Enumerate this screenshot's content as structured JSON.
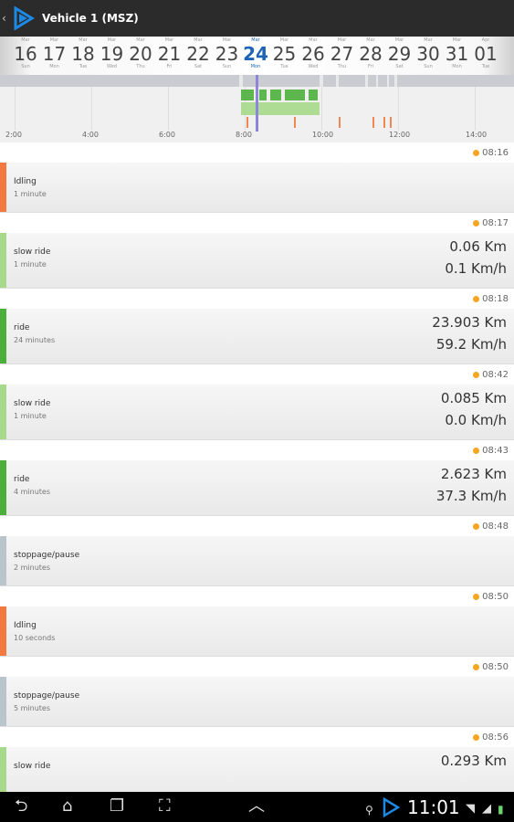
{
  "header": {
    "title": "Vehicle 1 (MSZ)",
    "back_glyph": "‹"
  },
  "dates": [
    {
      "mon": "Mar",
      "num": "16",
      "dow": "Sun",
      "selected": false
    },
    {
      "mon": "Mar",
      "num": "17",
      "dow": "Mon",
      "selected": false
    },
    {
      "mon": "Mar",
      "num": "18",
      "dow": "Tue",
      "selected": false
    },
    {
      "mon": "Mar",
      "num": "19",
      "dow": "Wed",
      "selected": false
    },
    {
      "mon": "Mar",
      "num": "20",
      "dow": "Thu",
      "selected": false
    },
    {
      "mon": "Mar",
      "num": "21",
      "dow": "Fri",
      "selected": false
    },
    {
      "mon": "Mar",
      "num": "22",
      "dow": "Sat",
      "selected": false
    },
    {
      "mon": "Mar",
      "num": "23",
      "dow": "Sun",
      "selected": false
    },
    {
      "mon": "Mar",
      "num": "24",
      "dow": "Mon",
      "selected": true
    },
    {
      "mon": "Mar",
      "num": "25",
      "dow": "Tue",
      "selected": false
    },
    {
      "mon": "Mar",
      "num": "26",
      "dow": "Wed",
      "selected": false
    },
    {
      "mon": "Mar",
      "num": "27",
      "dow": "Thu",
      "selected": false
    },
    {
      "mon": "Mar",
      "num": "28",
      "dow": "Fri",
      "selected": false
    },
    {
      "mon": "Mar",
      "num": "29",
      "dow": "Sat",
      "selected": false
    },
    {
      "mon": "Mar",
      "num": "30",
      "dow": "Sun",
      "selected": false
    },
    {
      "mon": "Mar",
      "num": "31",
      "dow": "Mon",
      "selected": false
    },
    {
      "mon": "Apr",
      "num": "01",
      "dow": "Tue",
      "selected": false
    }
  ],
  "timeline": {
    "hour_labels": [
      "2:00",
      "4:00",
      "6:00",
      "8:00",
      "10:00",
      "12:00",
      "14:00"
    ]
  },
  "events": [
    {
      "time": "08:16",
      "name": "Idling",
      "duration": "1 minute",
      "distance": "",
      "speed": "",
      "color": "#f07a3f"
    },
    {
      "time": "08:17",
      "name": "slow ride",
      "duration": "1 minute",
      "distance": "0.06 Km",
      "speed": "0.1 Km/h",
      "color": "#a6d98a"
    },
    {
      "time": "08:18",
      "name": "ride",
      "duration": "24 minutes",
      "distance": "23.903 Km",
      "speed": "59.2 Km/h",
      "color": "#4caf3c"
    },
    {
      "time": "08:42",
      "name": "slow ride",
      "duration": "1 minute",
      "distance": "0.085 Km",
      "speed": "0.0 Km/h",
      "color": "#a6d98a"
    },
    {
      "time": "08:43",
      "name": "ride",
      "duration": "4 minutes",
      "distance": "2.623 Km",
      "speed": "37.3 Km/h",
      "color": "#4caf3c"
    },
    {
      "time": "08:48",
      "name": "stoppage/pause",
      "duration": "2 minutes",
      "distance": "",
      "speed": "",
      "color": "#b9c4cc"
    },
    {
      "time": "08:50",
      "name": "Idling",
      "duration": "10 seconds",
      "distance": "",
      "speed": "",
      "color": "#f07a3f"
    },
    {
      "time": "08:50",
      "name": "stoppage/pause",
      "duration": "5 minutes",
      "distance": "",
      "speed": "",
      "color": "#b9c4cc"
    },
    {
      "time": "08:56",
      "name": "slow ride",
      "duration": "",
      "distance": "0.293 Km",
      "speed": "",
      "color": "#a6d98a"
    }
  ],
  "statusbar": {
    "clock": "11:01"
  },
  "colors": {
    "accent": "#1f63b8",
    "ride": "#4caf3c",
    "slow_ride": "#a6d98a",
    "idling": "#f07a3f",
    "stoppage": "#b9c4cc",
    "timestamp_dot": "#f5a623"
  }
}
